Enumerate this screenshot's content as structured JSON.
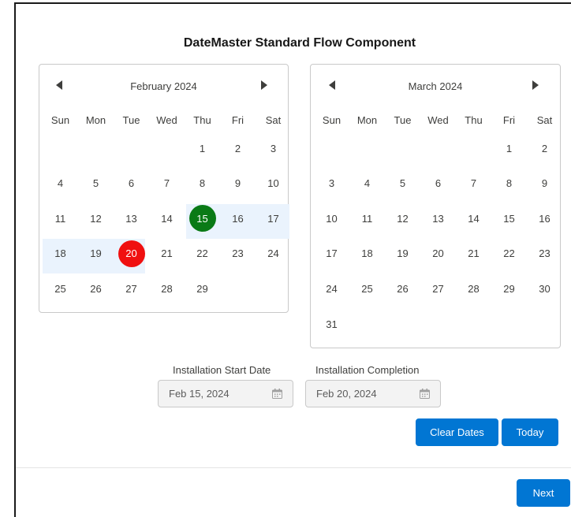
{
  "title": "DateMaster Standard Flow Component",
  "weekdays": [
    "Sun",
    "Mon",
    "Tue",
    "Wed",
    "Thu",
    "Fri",
    "Sat"
  ],
  "calendars": [
    {
      "month": "February 2024",
      "weeks": [
        [
          "",
          "",
          "",
          "",
          "1",
          "2",
          "3"
        ],
        [
          "4",
          "5",
          "6",
          "7",
          "8",
          "9",
          "10"
        ],
        [
          "11",
          "12",
          "13",
          "14",
          "15",
          "16",
          "17"
        ],
        [
          "18",
          "19",
          "20",
          "21",
          "22",
          "23",
          "24"
        ],
        [
          "25",
          "26",
          "27",
          "28",
          "29",
          "",
          ""
        ]
      ]
    },
    {
      "month": "March 2024",
      "weeks": [
        [
          "",
          "",
          "",
          "",
          "",
          "1",
          "2"
        ],
        [
          "3",
          "4",
          "5",
          "6",
          "7",
          "8",
          "9"
        ],
        [
          "10",
          "11",
          "12",
          "13",
          "14",
          "15",
          "16"
        ],
        [
          "17",
          "18",
          "19",
          "20",
          "21",
          "22",
          "23"
        ],
        [
          "24",
          "25",
          "26",
          "27",
          "28",
          "29",
          "30"
        ],
        [
          "31",
          "",
          "",
          "",
          "",
          "",
          ""
        ]
      ]
    }
  ],
  "selection": {
    "start_day": "15",
    "end_day": "20",
    "start_color": "#0a7a16",
    "end_color": "#f01010",
    "range_color": "#eaf3fd"
  },
  "fields": {
    "start_label": "Installation Start Date",
    "start_value": "Feb 15, 2024",
    "end_label": "Installation Completion",
    "end_value": "Feb 20, 2024"
  },
  "buttons": {
    "clear_label": "Clear Dates",
    "today_label": "Today",
    "next_label": "Next"
  },
  "icons": {
    "prev": "triangle-left-icon",
    "next": "triangle-right-icon",
    "field": "calendar-icon"
  },
  "accent_color": "#0176d3"
}
